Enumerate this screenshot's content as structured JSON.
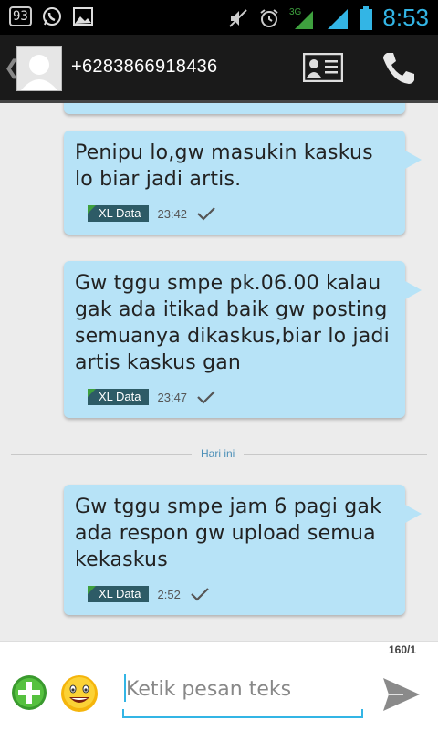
{
  "status_bar": {
    "badge": "93",
    "network": "3G",
    "time": "8:53"
  },
  "header": {
    "contact": "+6283866918436"
  },
  "thread": {
    "messages": [
      {
        "text": "Penipu lo,gw masukin kaskus lo biar jadi artis.",
        "carrier": "XL Data",
        "time": "23:42"
      },
      {
        "text": "Gw tggu smpe pk.06.00 kalau gak ada itikad baik gw posting semuanya dikaskus,biar lo jadi artis kaskus gan",
        "carrier": "XL Data",
        "time": "23:47"
      },
      {
        "text": "Gw tggu smpe jam 6 pagi gak ada respon gw upload semua kekaskus",
        "carrier": "XL Data",
        "time": "2:52"
      }
    ],
    "day_divider": "Hari ini"
  },
  "compose": {
    "counter": "160/1",
    "placeholder": "Ketik pesan teks"
  },
  "colors": {
    "bubble": "#b7e3f7",
    "accent": "#33b5e5",
    "carrier_badge": "#2d5b66",
    "signal_green": "#3ea03e"
  },
  "icons": [
    "back-chevron-icon",
    "avatar-placeholder-icon",
    "contact-card-icon",
    "phone-icon",
    "delivered-check-icon",
    "add-attachment-icon",
    "emoji-icon",
    "send-icon",
    "whatsapp-icon",
    "gallery-icon",
    "mute-icon",
    "alarm-icon",
    "signal-icon",
    "battery-icon"
  ]
}
